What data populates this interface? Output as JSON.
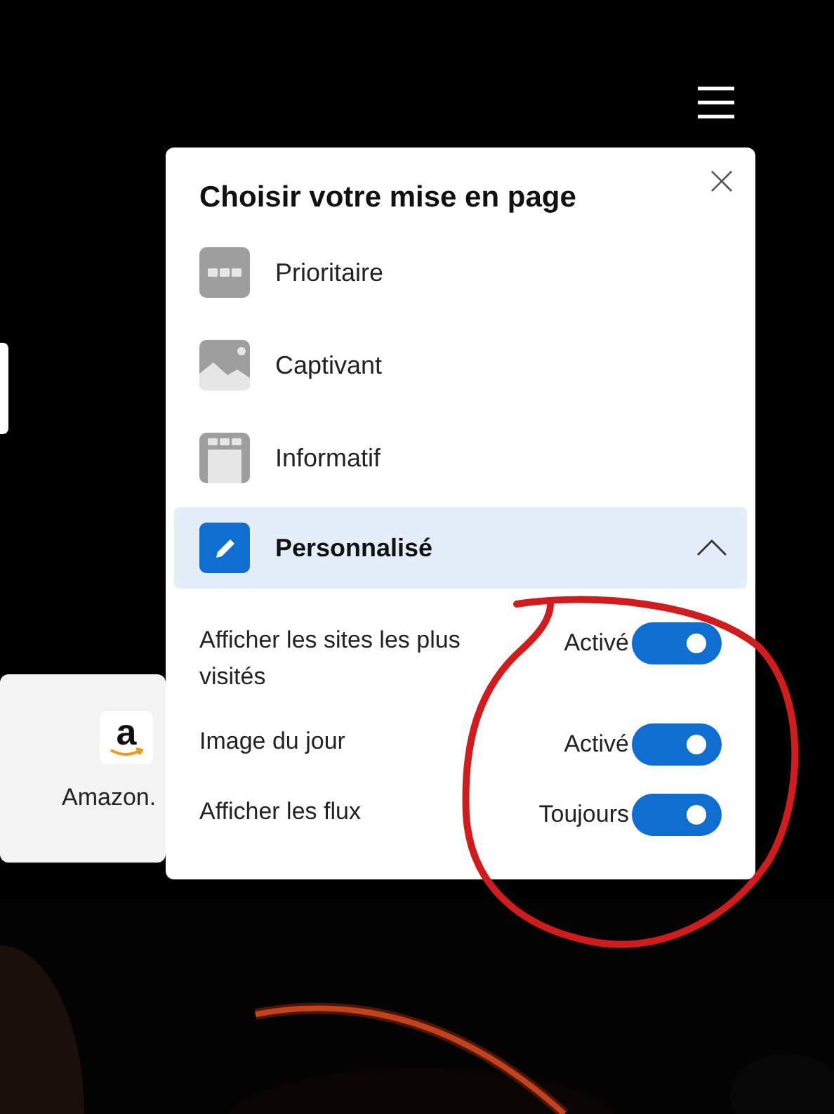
{
  "tile": {
    "logo_text": "a",
    "label": "Amazon."
  },
  "panel": {
    "title": "Choisir votre mise en page",
    "options": [
      {
        "label": "Prioritaire",
        "kind": "focused",
        "selected": false
      },
      {
        "label": "Captivant",
        "kind": "inspirational",
        "selected": false
      },
      {
        "label": "Informatif",
        "kind": "informational",
        "selected": false
      },
      {
        "label": "Personnalisé",
        "kind": "custom",
        "selected": true,
        "expanded": true
      }
    ],
    "settings": [
      {
        "label": "Afficher les sites les plus visités",
        "value": "Activé",
        "on": true
      },
      {
        "label": "Image du jour",
        "value": "Activé",
        "on": true
      },
      {
        "label": "Afficher les flux",
        "value": "Toujours",
        "on": true
      }
    ]
  }
}
